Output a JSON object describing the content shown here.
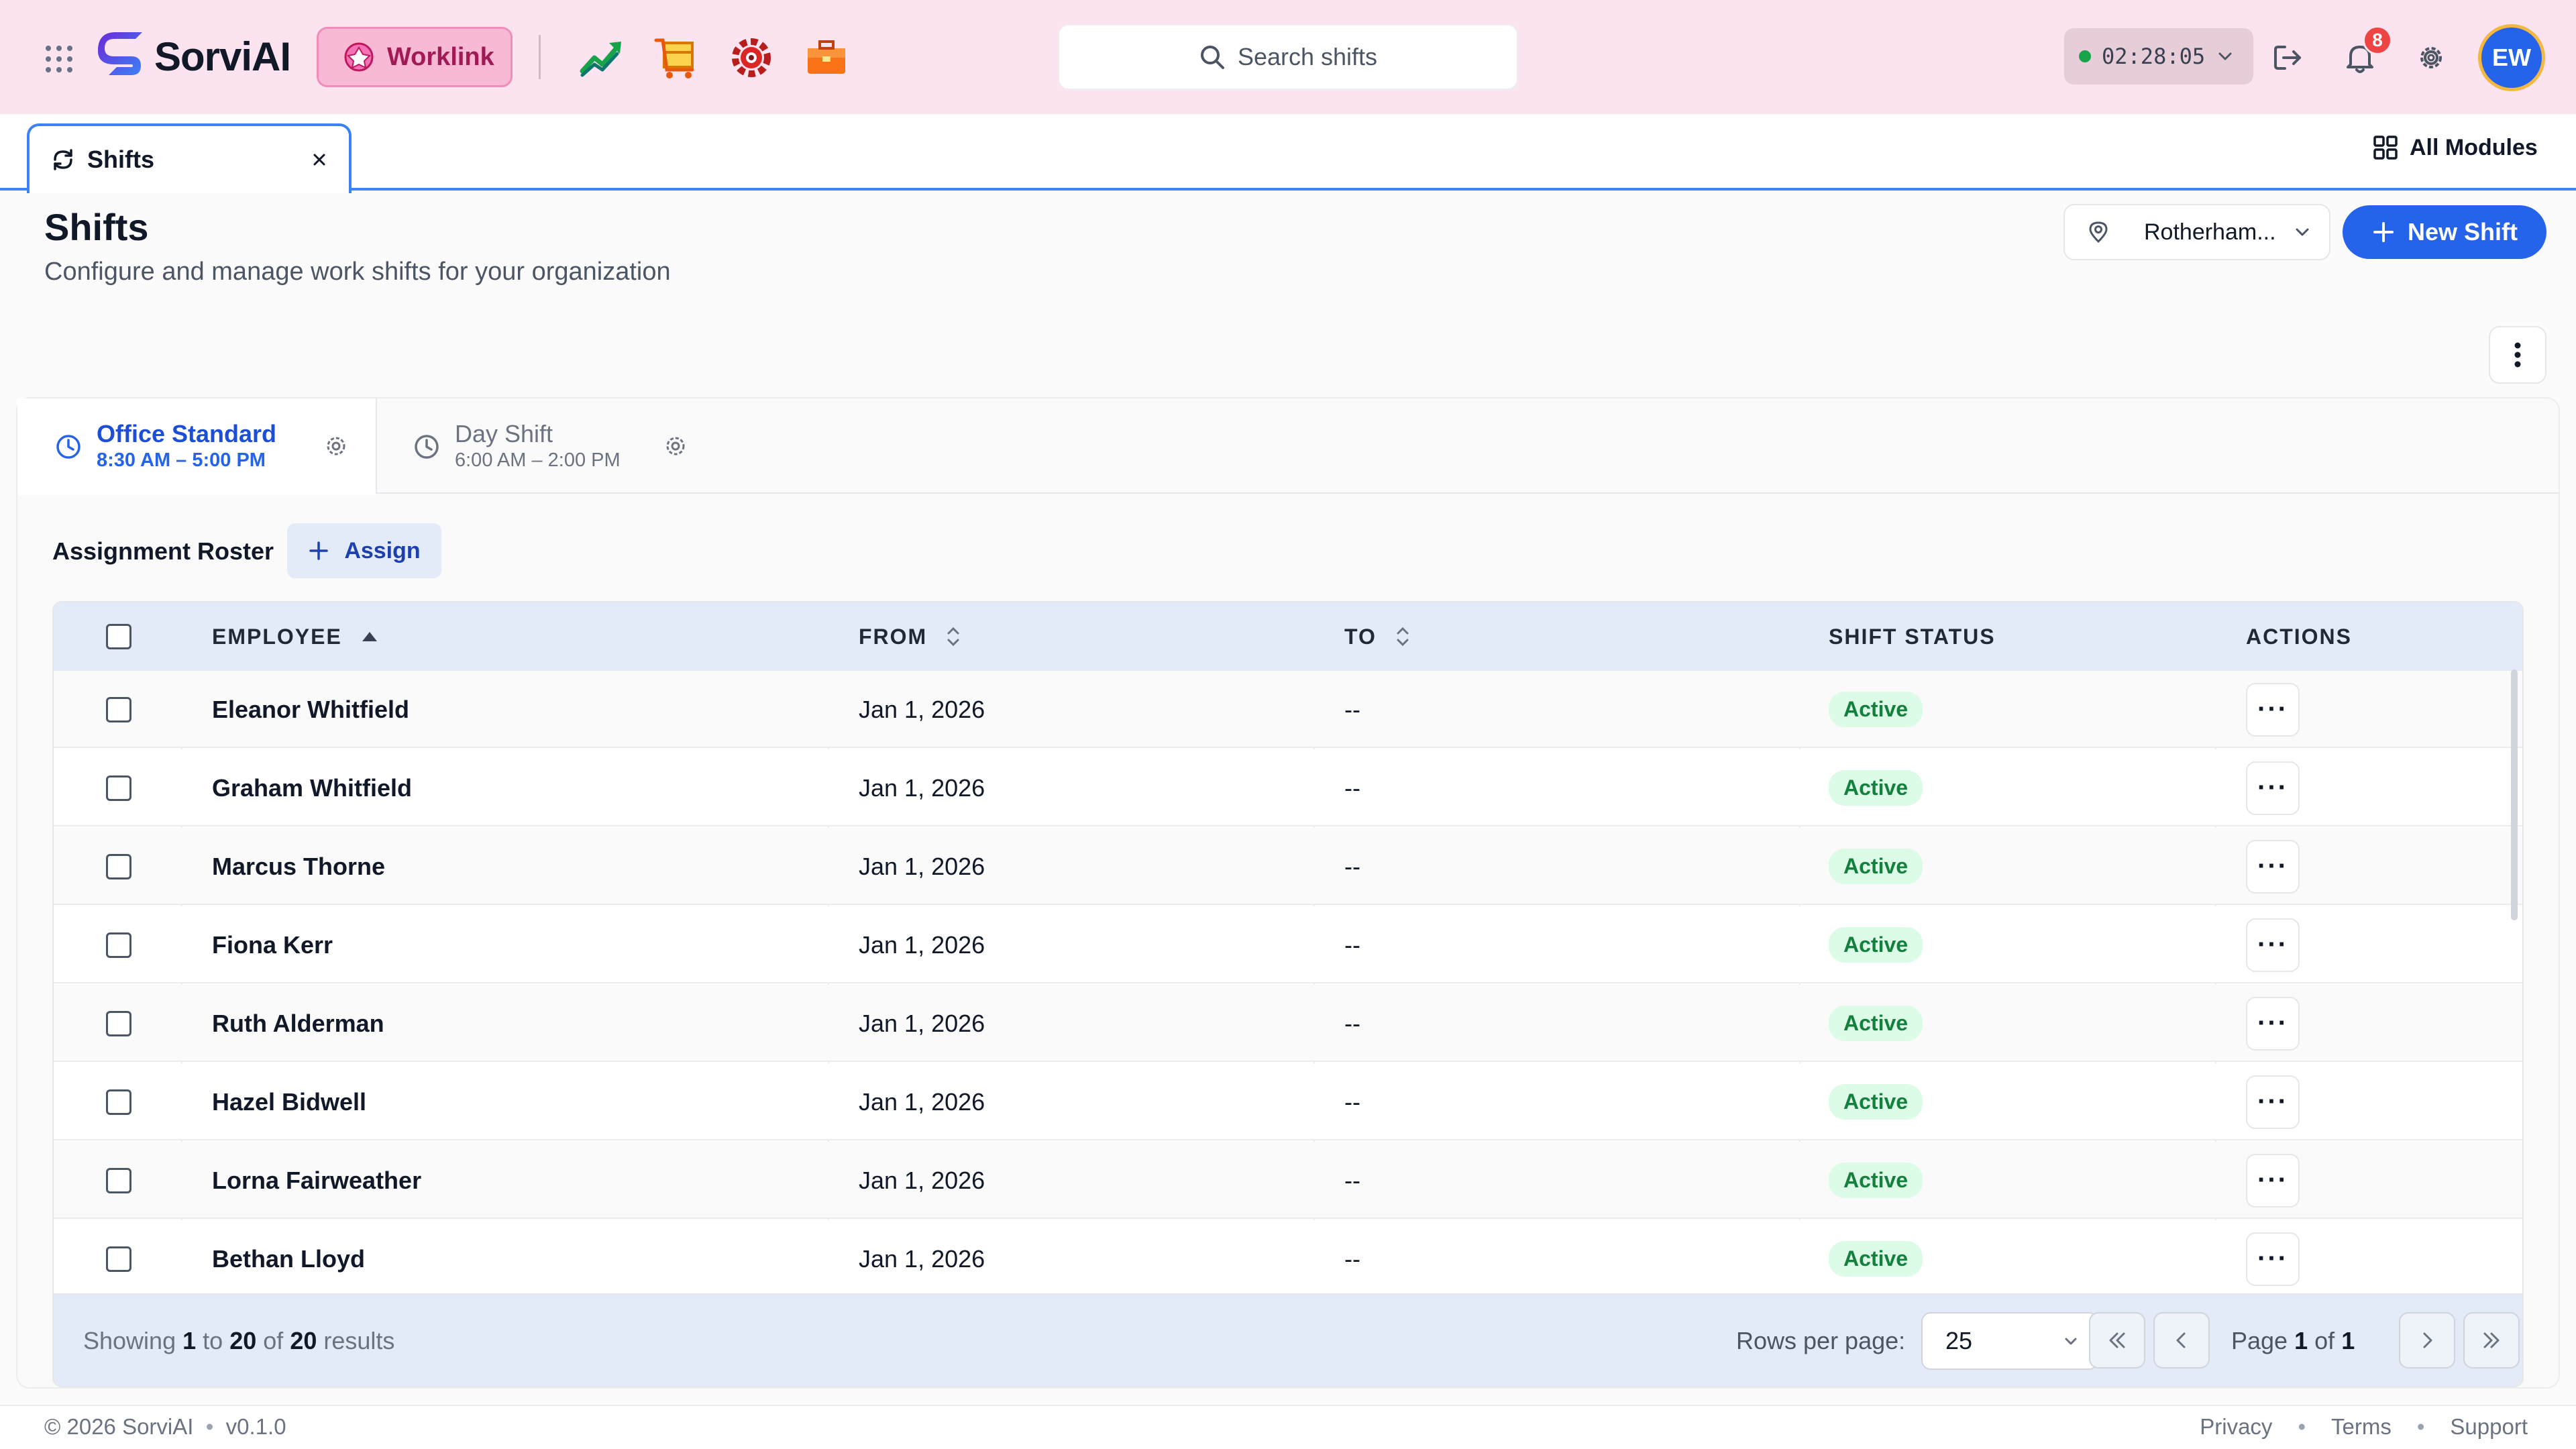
{
  "app": {
    "brand": "SorviAI"
  },
  "topbar": {
    "active_module": "Worklink",
    "module_icons": [
      "chart-up-icon",
      "box-icon",
      "gear-target-icon",
      "briefcase-icon"
    ],
    "search_placeholder": "Search shifts",
    "timer": "02:28:05",
    "notifications_count": "8",
    "avatar_initials": "EW"
  },
  "tabs": {
    "open": [
      {
        "label": "Shifts"
      }
    ],
    "all_modules_label": "All Modules"
  },
  "header": {
    "title": "Shifts",
    "subtitle": "Configure and manage work shifts for your organization",
    "location": "Rotherham...",
    "new_shift_label": "New Shift"
  },
  "shift_tabs": [
    {
      "name": "Office Standard",
      "time": "8:30 AM – 5:00 PM",
      "active": true
    },
    {
      "name": "Day Shift",
      "time": "6:00 AM – 2:00 PM",
      "active": false
    }
  ],
  "roster": {
    "label": "Assignment Roster",
    "assign_label": "Assign",
    "columns": {
      "employee": "EMPLOYEE",
      "from": "FROM",
      "to": "TO",
      "status": "SHIFT STATUS",
      "actions": "ACTIONS"
    },
    "rows": [
      {
        "employee": "Eleanor Whitfield",
        "from": "Jan 1, 2026",
        "to": "--",
        "status": "Active"
      },
      {
        "employee": "Graham Whitfield",
        "from": "Jan 1, 2026",
        "to": "--",
        "status": "Active"
      },
      {
        "employee": "Marcus Thorne",
        "from": "Jan 1, 2026",
        "to": "--",
        "status": "Active"
      },
      {
        "employee": "Fiona Kerr",
        "from": "Jan 1, 2026",
        "to": "--",
        "status": "Active"
      },
      {
        "employee": "Ruth Alderman",
        "from": "Jan 1, 2026",
        "to": "--",
        "status": "Active"
      },
      {
        "employee": "Hazel Bidwell",
        "from": "Jan 1, 2026",
        "to": "--",
        "status": "Active"
      },
      {
        "employee": "Lorna Fairweather",
        "from": "Jan 1, 2026",
        "to": "--",
        "status": "Active"
      },
      {
        "employee": "Bethan Lloyd",
        "from": "Jan 1, 2026",
        "to": "--",
        "status": "Active"
      }
    ],
    "actions_label": "···"
  },
  "pagination": {
    "showing_prefix": "Showing",
    "from": "1",
    "to_word": "to",
    "to": "20",
    "of_word": "of",
    "total": "20",
    "results_word": "results",
    "rows_per_page_label": "Rows per page:",
    "rows_per_page": "25",
    "page_word": "Page",
    "page": "1",
    "of_pages_word": "of",
    "pages": "1"
  },
  "footer": {
    "copyright": "© 2026 SorviAI",
    "version": "v0.1.0",
    "links": [
      "Privacy",
      "Terms",
      "Support"
    ]
  },
  "colors": {
    "accent": "#2563eb",
    "topbar_bg": "#fbe4ef",
    "worklink_bg": "#f7b9d3",
    "status_active": "#15803d"
  }
}
